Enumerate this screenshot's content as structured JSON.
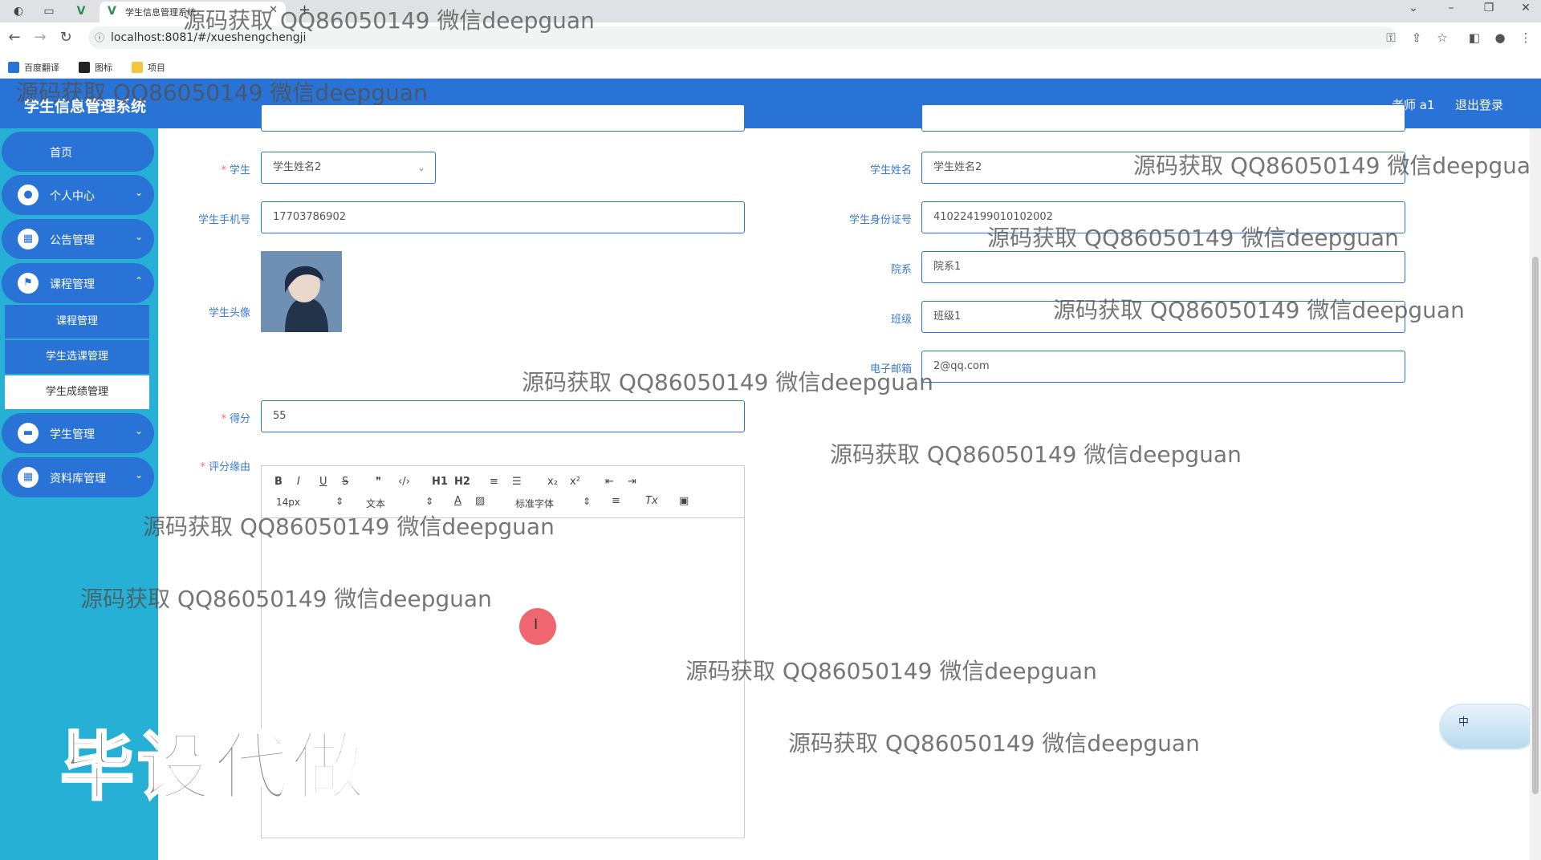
{
  "browser": {
    "tab_title": "学生信息管理系统",
    "url": "localhost:8081/#/xueshengchengji",
    "bookmarks": [
      "百度翻译",
      "图标",
      "项目"
    ]
  },
  "header": {
    "app_title": "学生信息管理系统",
    "user_label": "老师 a1",
    "logout_label": "退出登录"
  },
  "sidebar": {
    "home": "首页",
    "items": [
      {
        "label": "个人中心",
        "icon": "user-icon"
      },
      {
        "label": "公告管理",
        "icon": "grid-icon"
      },
      {
        "label": "课程管理",
        "icon": "flag-icon"
      }
    ],
    "sub_items": [
      "课程管理",
      "学生选课管理",
      "学生成绩管理"
    ],
    "items_after": [
      {
        "label": "学生管理",
        "icon": "monitor-icon"
      },
      {
        "label": "资料库管理",
        "icon": "grid-icon"
      }
    ]
  },
  "form": {
    "student": {
      "label": "学生",
      "value": "学生姓名2"
    },
    "student_name": {
      "label": "学生姓名",
      "value": "学生姓名2"
    },
    "student_phone": {
      "label": "学生手机号",
      "value": "17703786902"
    },
    "student_id_card": {
      "label": "学生身份证号",
      "value": "410224199010102002"
    },
    "department": {
      "label": "院系",
      "value": "院系1"
    },
    "class": {
      "label": "班级",
      "value": "班级1"
    },
    "avatar": {
      "label": "学生头像"
    },
    "email": {
      "label": "电子邮箱",
      "value": "2@qq.com"
    },
    "score": {
      "label": "得分",
      "value": "55"
    },
    "reason": {
      "label": "评分缘由"
    }
  },
  "editor": {
    "toolbar_row1": [
      "B",
      "I",
      "U",
      "S",
      "❞",
      "‹/›",
      "H1",
      "H2",
      "≡",
      "☰",
      "x₂",
      "x²",
      "⇤",
      "⇥"
    ],
    "font_size": "14px",
    "paragraph": "文本",
    "font_family": "标准字体"
  },
  "watermarks": {
    "text": "源码获取 QQ86050149 微信deepguan",
    "big": "毕设代做"
  },
  "widget": {
    "label": "中"
  }
}
